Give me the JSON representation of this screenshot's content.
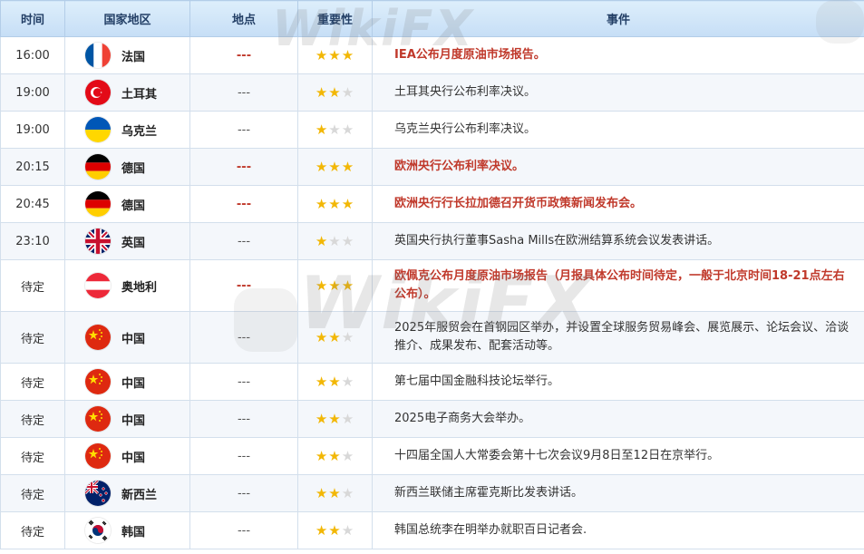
{
  "headers": {
    "time": "时间",
    "country": "国家地区",
    "location": "地点",
    "importance": "重要性",
    "event": "事件"
  },
  "watermark": "WikiFX",
  "rows": [
    {
      "time": "16:00",
      "country": "法国",
      "flag": "france-flag-icon",
      "location": "---",
      "stars": 3,
      "event": "IEA公布月度原油市场报告。",
      "highlight": true
    },
    {
      "time": "19:00",
      "country": "土耳其",
      "flag": "turkey-flag-icon",
      "location": "---",
      "stars": 2,
      "event": "土耳其央行公布利率决议。",
      "highlight": false
    },
    {
      "time": "19:00",
      "country": "乌克兰",
      "flag": "ukraine-flag-icon",
      "location": "---",
      "stars": 1,
      "event": "乌克兰央行公布利率决议。",
      "highlight": false
    },
    {
      "time": "20:15",
      "country": "德国",
      "flag": "germany-flag-icon",
      "location": "---",
      "stars": 3,
      "event": "欧洲央行公布利率决议。",
      "highlight": true
    },
    {
      "time": "20:45",
      "country": "德国",
      "flag": "germany-flag-icon",
      "location": "---",
      "stars": 3,
      "event": "欧洲央行行长拉加德召开货币政策新闻发布会。",
      "highlight": true
    },
    {
      "time": "23:10",
      "country": "英国",
      "flag": "uk-flag-icon",
      "location": "---",
      "stars": 1,
      "event": "英国央行执行董事Sasha Mills在欧洲结算系统会议发表讲话。",
      "highlight": false
    },
    {
      "time": "待定",
      "country": "奥地利",
      "flag": "austria-flag-icon",
      "location": "---",
      "stars": 3,
      "event": "欧佩克公布月度原油市场报告（月报具体公布时间待定，一般于北京时间18-21点左右公布）。",
      "highlight": true
    },
    {
      "time": "待定",
      "country": "中国",
      "flag": "china-flag-icon",
      "location": "---",
      "stars": 2,
      "event": "2025年服贸会在首钢园区举办，并设置全球服务贸易峰会、展览展示、论坛会议、洽谈推介、成果发布、配套活动等。",
      "highlight": false
    },
    {
      "time": "待定",
      "country": "中国",
      "flag": "china-flag-icon",
      "location": "---",
      "stars": 2,
      "event": "第七届中国金融科技论坛举行。",
      "highlight": false
    },
    {
      "time": "待定",
      "country": "中国",
      "flag": "china-flag-icon",
      "location": "---",
      "stars": 2,
      "event": "2025电子商务大会举办。",
      "highlight": false
    },
    {
      "time": "待定",
      "country": "中国",
      "flag": "china-flag-icon",
      "location": "---",
      "stars": 2,
      "event": "十四届全国人大常委会第十七次会议9月8日至12日在京举行。",
      "highlight": false
    },
    {
      "time": "待定",
      "country": "新西兰",
      "flag": "new-zealand-flag-icon",
      "location": "---",
      "stars": 2,
      "event": "新西兰联储主席霍克斯比发表讲话。",
      "highlight": false
    },
    {
      "time": "待定",
      "country": "韩国",
      "flag": "south-korea-flag-icon",
      "location": "---",
      "stars": 2,
      "event": "韩国总统李在明举办就职百日记者会.",
      "highlight": false
    }
  ],
  "colors": {
    "header_bg": "#c6def6",
    "header_text": "#233f66",
    "highlight_text": "#c0392b",
    "star_on": "#f2b705",
    "star_off": "#d8d8d8"
  }
}
